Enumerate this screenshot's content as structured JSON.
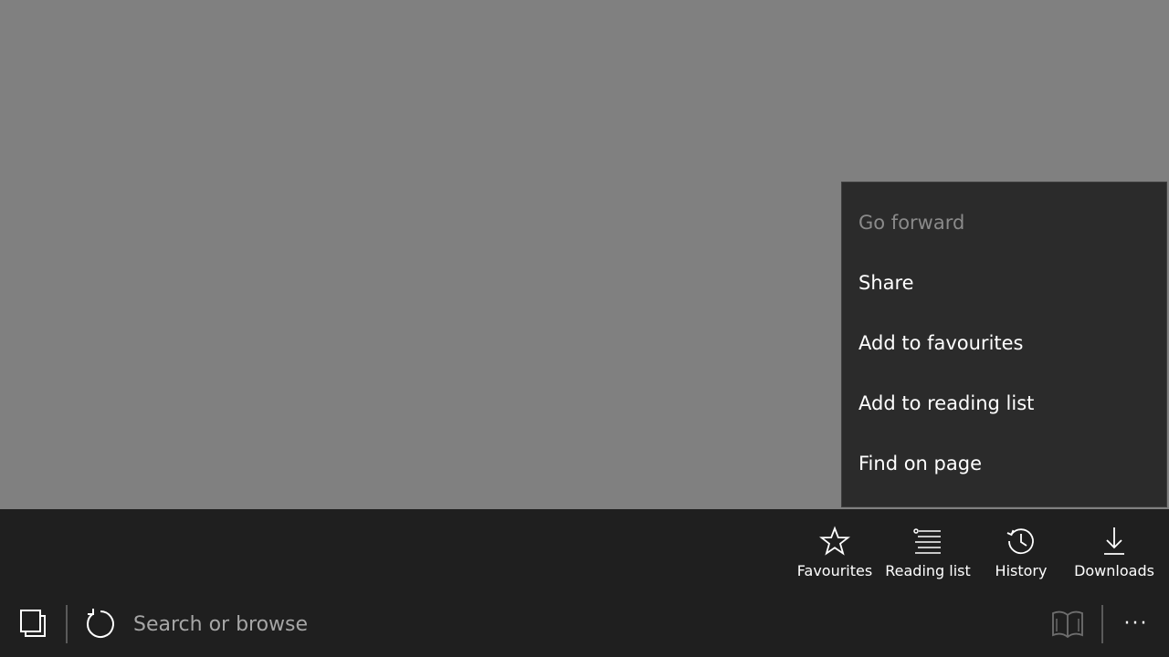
{
  "context_menu": {
    "items": [
      {
        "label": "Go forward",
        "enabled": false
      },
      {
        "label": "Share",
        "enabled": true
      },
      {
        "label": "Add to favourites",
        "enabled": true
      },
      {
        "label": "Add to reading list",
        "enabled": true
      },
      {
        "label": "Find on page",
        "enabled": true
      }
    ]
  },
  "app_bar": {
    "quick_links": [
      {
        "label": "Favourites",
        "icon": "star-icon"
      },
      {
        "label": "Reading list",
        "icon": "reading-list-icon"
      },
      {
        "label": "History",
        "icon": "history-icon"
      },
      {
        "label": "Downloads",
        "icon": "download-icon"
      }
    ],
    "address": {
      "placeholder": "Search or browse",
      "value": ""
    },
    "more_label": "···"
  },
  "colors": {
    "page_background": "#808080",
    "menu_background": "#2b2b2b",
    "app_bar_background": "#1f1f1f",
    "text": "#ffffff",
    "disabled_text": "#8a8a8a"
  }
}
